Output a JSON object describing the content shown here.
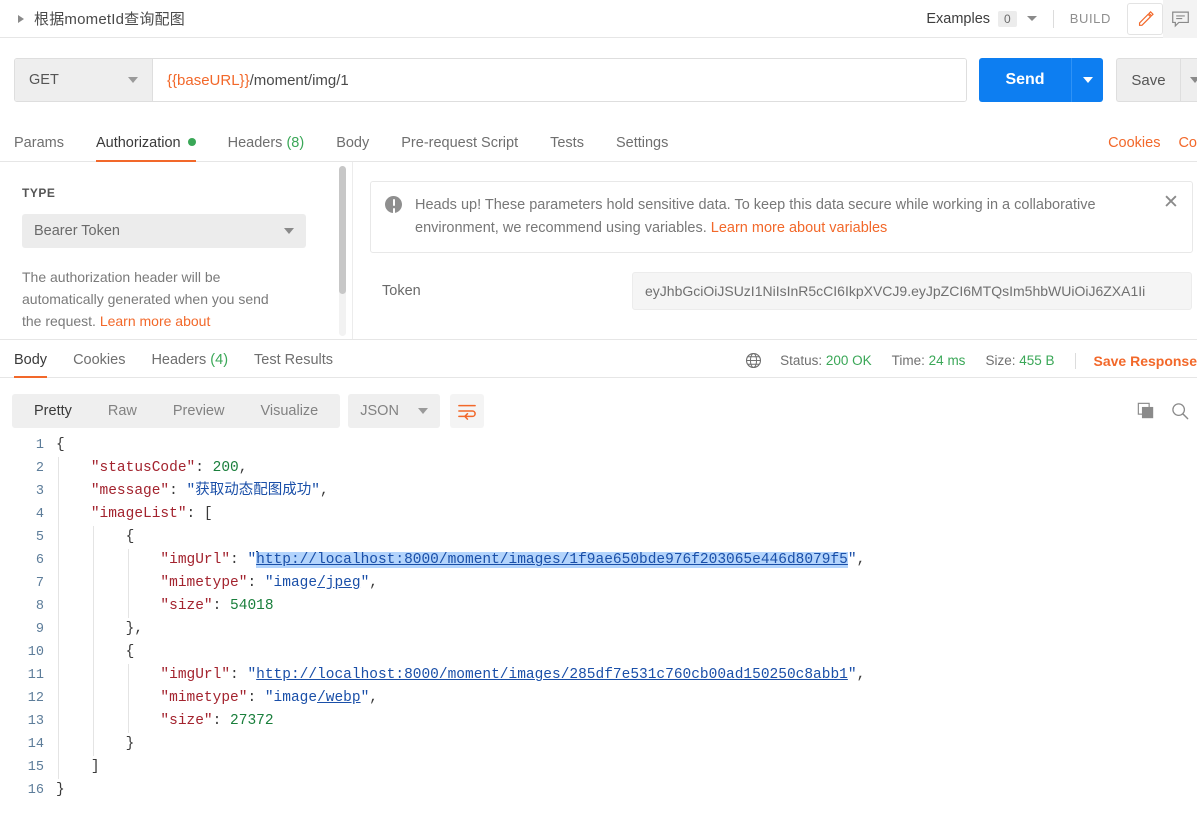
{
  "titlebar": {
    "request_name": "根据mometId查询配图",
    "examples_label": "Examples",
    "examples_count": "0",
    "build_label": "BUILD",
    "edit_icon": "pencil-icon",
    "comment_icon": "comment-icon"
  },
  "urlbar": {
    "method": "GET",
    "url_variable": "{{baseURL}}",
    "url_path": "/moment/img/1",
    "send_label": "Send",
    "save_label": "Save"
  },
  "request_tabs": {
    "items": [
      {
        "label": "Params",
        "active": false
      },
      {
        "label": "Authorization",
        "active": true,
        "dot": true
      },
      {
        "label": "Headers",
        "count": "(8)",
        "active": false
      },
      {
        "label": "Body",
        "active": false
      },
      {
        "label": "Pre-request Script",
        "active": false
      },
      {
        "label": "Tests",
        "active": false
      },
      {
        "label": "Settings",
        "active": false
      }
    ],
    "cookies_link": "Cookies",
    "code_link": "Co"
  },
  "authorization": {
    "type_label": "TYPE",
    "type_value": "Bearer Token",
    "help_text": "The authorization header will be automatically generated when you send the request. ",
    "help_link": "Learn more about",
    "banner": {
      "icon": "alert-icon",
      "text": "Heads up! These parameters hold sensitive data. To keep this data secure while working in a collaborative environment, we recommend using variables. ",
      "link": "Learn more about variables",
      "close": "✕"
    },
    "token_label": "Token",
    "token_value": "eyJhbGciOiJSUzI1NiIsInR5cCI6IkpXVCJ9.eyJpZCI6MTQsIm5hbWUiOiJ6ZXA1Ii"
  },
  "response": {
    "tabs": [
      {
        "label": "Body",
        "active": true
      },
      {
        "label": "Cookies",
        "active": false
      },
      {
        "label": "Headers",
        "count": "(4)",
        "active": false
      },
      {
        "label": "Test Results",
        "active": false
      }
    ],
    "globe_icon": "globe-icon",
    "status_label": "Status:",
    "status_value": "200 OK",
    "time_label": "Time:",
    "time_value": "24 ms",
    "size_label": "Size:",
    "size_value": "455 B",
    "save_response": "Save Response"
  },
  "body_toolbar": {
    "segments": [
      {
        "label": "Pretty",
        "active": true
      },
      {
        "label": "Raw",
        "active": false
      },
      {
        "label": "Preview",
        "active": false
      },
      {
        "label": "Visualize",
        "active": false
      }
    ],
    "format": "JSON",
    "wrap_icon": "word-wrap-icon",
    "copy_icon": "copy-icon",
    "search_icon": "search-icon"
  },
  "code": {
    "lines": [
      {
        "n": "1",
        "indent": 0,
        "guides": 0,
        "parts": [
          {
            "t": "{",
            "c": "k-punc"
          }
        ]
      },
      {
        "n": "2",
        "indent": 4,
        "guides": 1,
        "parts": [
          {
            "t": "\"statusCode\"",
            "c": "k-key"
          },
          {
            "t": ": ",
            "c": "k-punc"
          },
          {
            "t": "200",
            "c": "k-num"
          },
          {
            "t": ",",
            "c": "k-punc"
          }
        ]
      },
      {
        "n": "3",
        "indent": 4,
        "guides": 1,
        "parts": [
          {
            "t": "\"message\"",
            "c": "k-key"
          },
          {
            "t": ": ",
            "c": "k-punc"
          },
          {
            "t": "\"获取动态配图成功\"",
            "c": "k-str"
          },
          {
            "t": ",",
            "c": "k-punc"
          }
        ]
      },
      {
        "n": "4",
        "indent": 4,
        "guides": 1,
        "parts": [
          {
            "t": "\"imageList\"",
            "c": "k-key"
          },
          {
            "t": ": [",
            "c": "k-punc"
          }
        ]
      },
      {
        "n": "5",
        "indent": 8,
        "guides": 2,
        "parts": [
          {
            "t": "{",
            "c": "k-punc"
          }
        ]
      },
      {
        "n": "6",
        "indent": 12,
        "guides": 3,
        "parts": [
          {
            "t": "\"imgUrl\"",
            "c": "k-key"
          },
          {
            "t": ": ",
            "c": "k-punc"
          },
          {
            "t": "\"",
            "c": "k-str"
          },
          {
            "t": "http://localhost:8000/moment/images/1f9ae650bde976f203065e446d8079f5",
            "c": "k-link sel",
            "caret": true
          },
          {
            "t": "\"",
            "c": "k-str"
          },
          {
            "t": ",",
            "c": "k-punc"
          }
        ]
      },
      {
        "n": "7",
        "indent": 12,
        "guides": 3,
        "parts": [
          {
            "t": "\"mimetype\"",
            "c": "k-key"
          },
          {
            "t": ": ",
            "c": "k-punc"
          },
          {
            "t": "\"image",
            "c": "k-str"
          },
          {
            "t": "/jpeg",
            "c": "k-link"
          },
          {
            "t": "\"",
            "c": "k-str"
          },
          {
            "t": ",",
            "c": "k-punc"
          }
        ]
      },
      {
        "n": "8",
        "indent": 12,
        "guides": 3,
        "parts": [
          {
            "t": "\"size\"",
            "c": "k-key"
          },
          {
            "t": ": ",
            "c": "k-punc"
          },
          {
            "t": "54018",
            "c": "k-num"
          }
        ]
      },
      {
        "n": "9",
        "indent": 8,
        "guides": 2,
        "parts": [
          {
            "t": "},",
            "c": "k-punc"
          }
        ]
      },
      {
        "n": "10",
        "indent": 8,
        "guides": 2,
        "parts": [
          {
            "t": "{",
            "c": "k-punc"
          }
        ]
      },
      {
        "n": "11",
        "indent": 12,
        "guides": 3,
        "parts": [
          {
            "t": "\"imgUrl\"",
            "c": "k-key"
          },
          {
            "t": ": ",
            "c": "k-punc"
          },
          {
            "t": "\"",
            "c": "k-str"
          },
          {
            "t": "http://localhost:8000/moment/images/285df7e531c760cb00ad150250c8abb1",
            "c": "k-link"
          },
          {
            "t": "\"",
            "c": "k-str"
          },
          {
            "t": ",",
            "c": "k-punc"
          }
        ]
      },
      {
        "n": "12",
        "indent": 12,
        "guides": 3,
        "parts": [
          {
            "t": "\"mimetype\"",
            "c": "k-key"
          },
          {
            "t": ": ",
            "c": "k-punc"
          },
          {
            "t": "\"image",
            "c": "k-str"
          },
          {
            "t": "/webp",
            "c": "k-link"
          },
          {
            "t": "\"",
            "c": "k-str"
          },
          {
            "t": ",",
            "c": "k-punc"
          }
        ]
      },
      {
        "n": "13",
        "indent": 12,
        "guides": 3,
        "parts": [
          {
            "t": "\"size\"",
            "c": "k-key"
          },
          {
            "t": ": ",
            "c": "k-punc"
          },
          {
            "t": "27372",
            "c": "k-num"
          }
        ]
      },
      {
        "n": "14",
        "indent": 8,
        "guides": 2,
        "parts": [
          {
            "t": "}",
            "c": "k-punc"
          }
        ]
      },
      {
        "n": "15",
        "indent": 4,
        "guides": 1,
        "parts": [
          {
            "t": "]",
            "c": "k-punc"
          }
        ]
      },
      {
        "n": "16",
        "indent": 0,
        "guides": 0,
        "parts": [
          {
            "t": "}",
            "c": "k-punc"
          }
        ]
      }
    ]
  }
}
